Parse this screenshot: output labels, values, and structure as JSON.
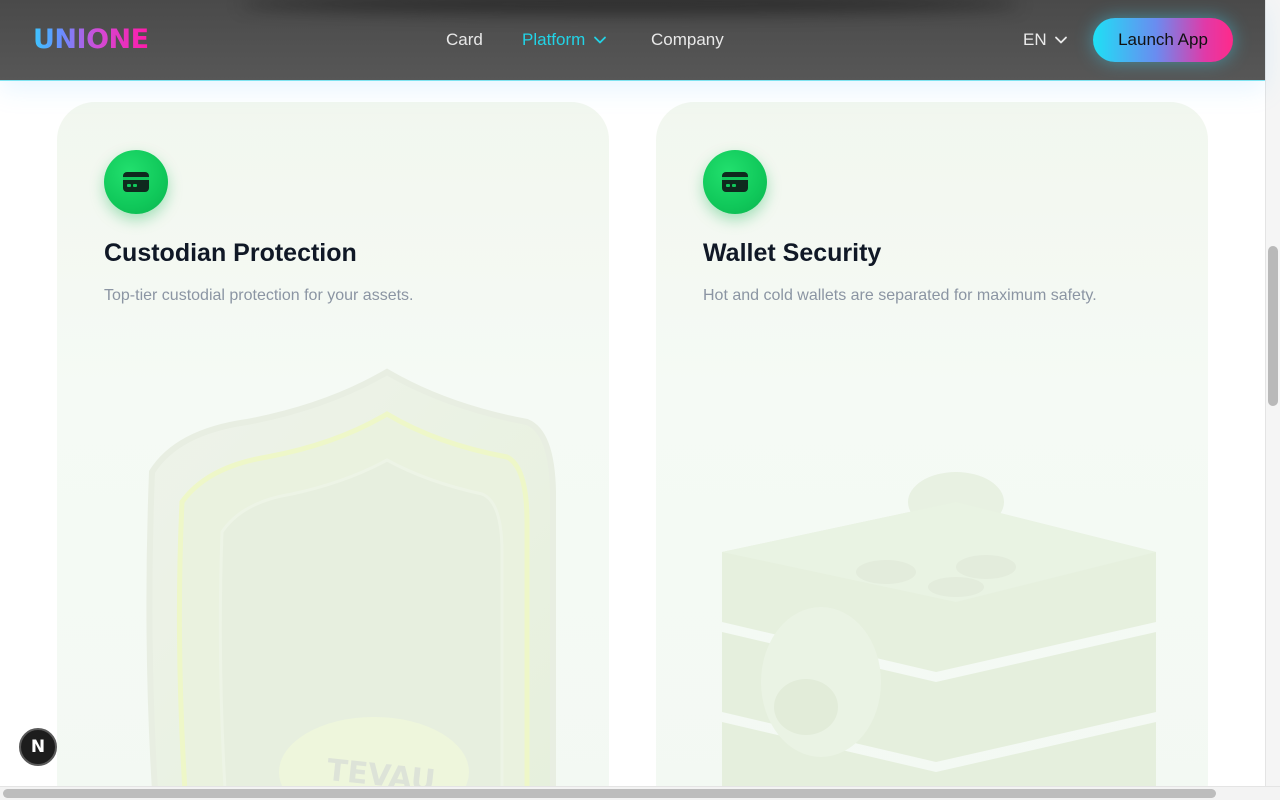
{
  "header": {
    "logo": "UNIONE",
    "nav": [
      {
        "label": "Card"
      },
      {
        "label": "Platform"
      },
      {
        "label": "Company"
      }
    ],
    "language": "EN",
    "launch_label": "Launch App"
  },
  "cards": [
    {
      "icon": "credit-card-icon",
      "title": "Custodian Protection",
      "description": "Top-tier custodial protection for your assets.",
      "illustration": "shield-illustration",
      "illustration_text": "TEVAU"
    },
    {
      "icon": "credit-card-icon",
      "title": "Wallet Security",
      "description": "Hot and cold wallets are separated for maximum safety.",
      "illustration": "safe-box-illustration"
    }
  ],
  "dev_badge": "N",
  "colors": {
    "accent_cyan": "#22d3e6",
    "icon_green": "#10c85a",
    "launch_gradient_start": "#1ee0f5",
    "launch_gradient_end": "#ff2a8a"
  }
}
